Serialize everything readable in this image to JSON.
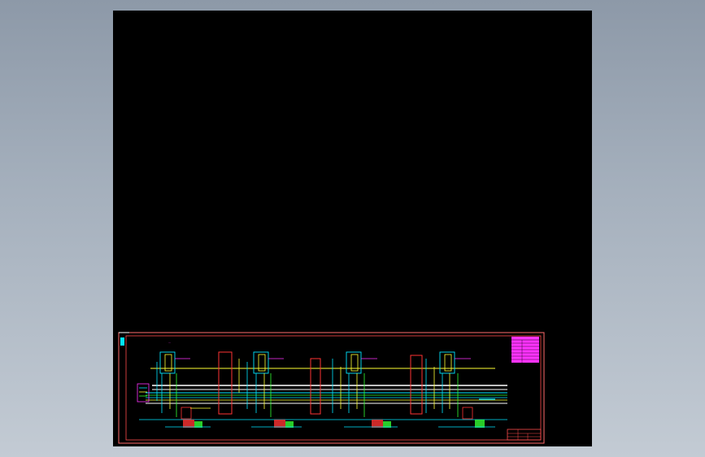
{
  "colors": {
    "background_top": "#8d99a8",
    "background_bottom": "#c3cbd4",
    "model_space": "#000000",
    "border": "#ff6b6b",
    "pipe_cyan": "#00e5ff",
    "pipe_yellow": "#ffff33",
    "pipe_white": "#ffffff",
    "vessel_red": "#ff3333",
    "valve_green": "#33ff33",
    "table_magenta": "#ff33ff"
  },
  "drawing": {
    "type": "process flow diagram (CAD drawing sheet)",
    "process_units": 4,
    "has_legend_table": true,
    "has_title_block": true
  }
}
